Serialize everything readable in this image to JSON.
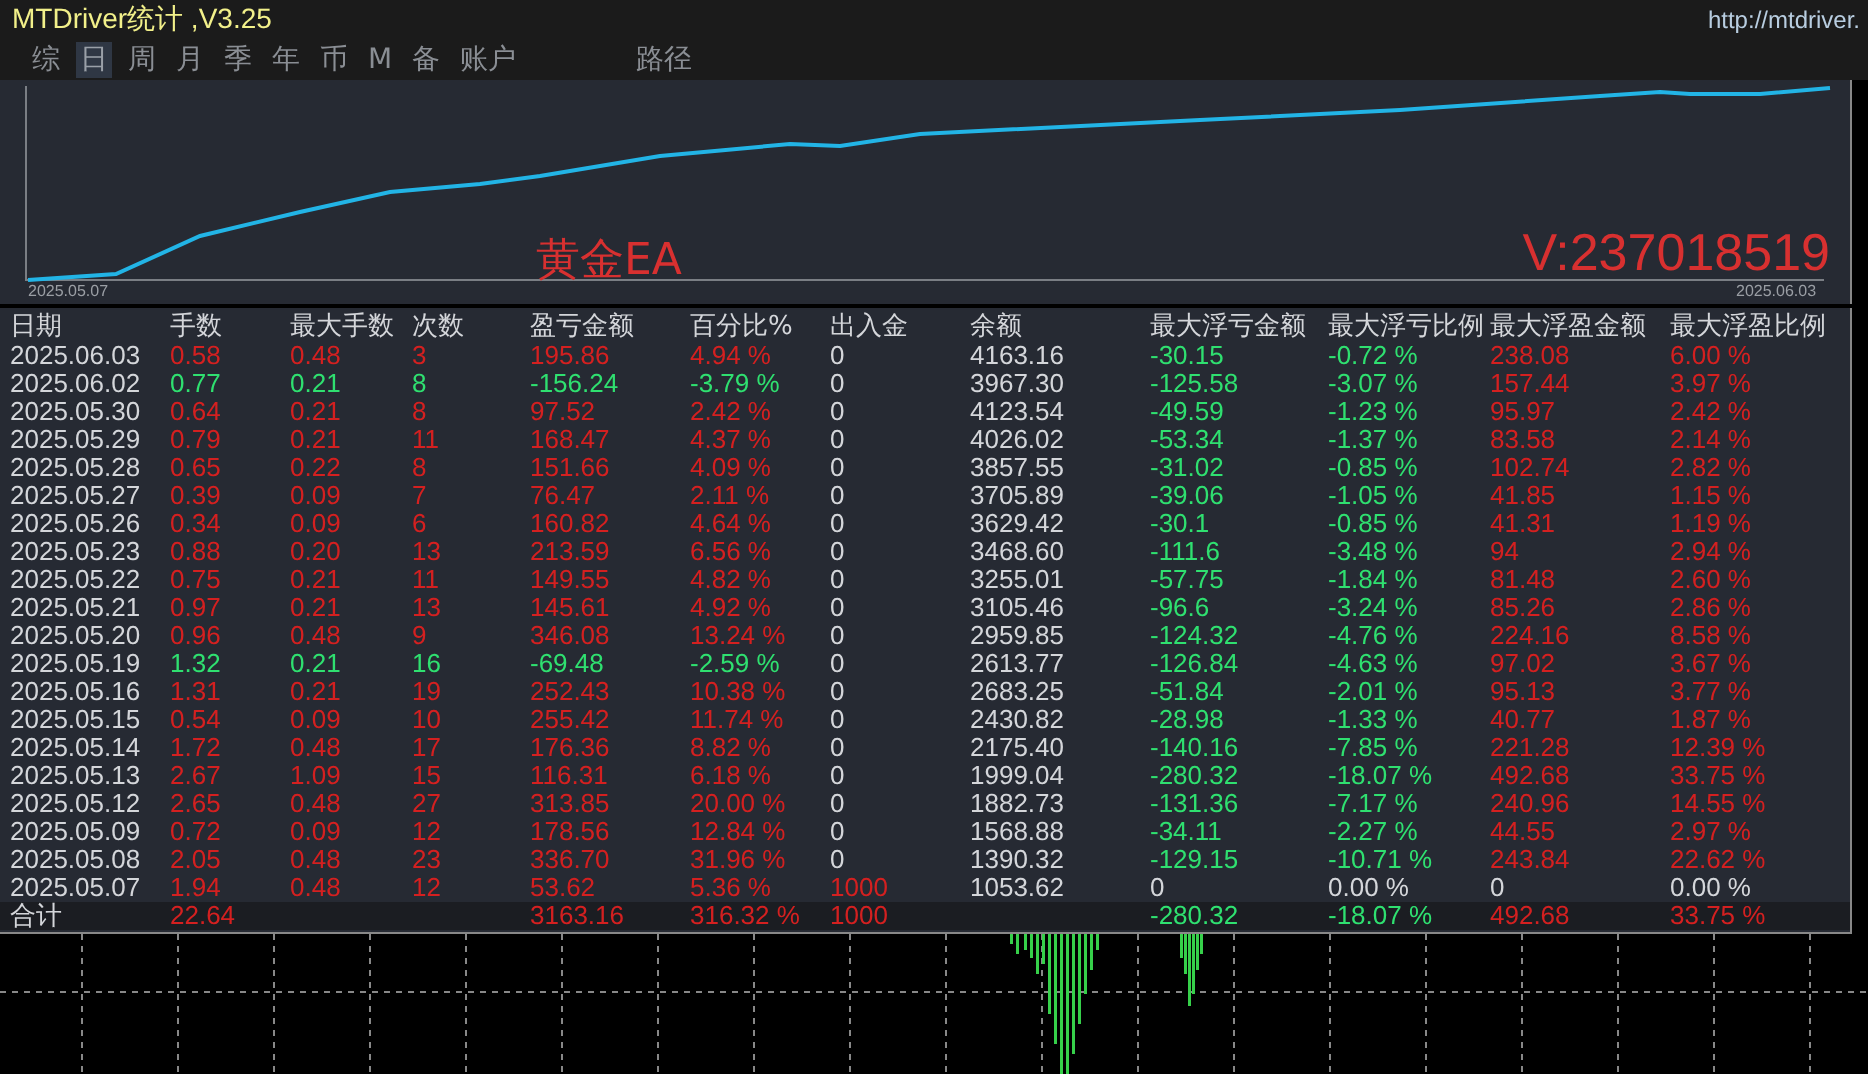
{
  "window": {
    "title": "MTDriver统计 ,V3.25",
    "url": "http://mtdriver."
  },
  "tabs": [
    {
      "label": "综",
      "selected": false
    },
    {
      "label": "日",
      "selected": true
    },
    {
      "label": "周",
      "selected": false
    },
    {
      "label": "月",
      "selected": false
    },
    {
      "label": "季",
      "selected": false
    },
    {
      "label": "年",
      "selected": false
    },
    {
      "label": "币",
      "selected": false
    },
    {
      "label": "M",
      "selected": false
    },
    {
      "label": "备",
      "selected": false
    },
    {
      "label": "账户",
      "selected": false
    },
    {
      "label": "路径",
      "selected": false
    }
  ],
  "chart": {
    "start_label": "2025.05.07",
    "end_label": "2025.06.03",
    "title": "黄金EA",
    "account": "V:237018519"
  },
  "table": {
    "columns": [
      "日期",
      "手数",
      "最大手数",
      "次数",
      "盈亏金额",
      "百分比%",
      "出入金",
      "余额",
      "最大浮亏金额",
      "最大浮亏比例",
      "最大浮盈金额",
      "最大浮盈比例"
    ],
    "rows": [
      {
        "cells": [
          {
            "text": "2025.06.03"
          },
          {
            "text": "0.58",
            "color": "#d42020"
          },
          {
            "text": "0.48",
            "color": "#d42020"
          },
          {
            "text": "3",
            "color": "#d42020"
          },
          {
            "text": "195.86",
            "color": "#d42020"
          },
          {
            "text": "4.94 %",
            "color": "#d42020"
          },
          {
            "text": "0"
          },
          {
            "text": "4163.16"
          },
          {
            "text": "-30.15",
            "color": "#2fe070"
          },
          {
            "text": "-0.72 %",
            "color": "#2fe070"
          },
          {
            "text": "238.08",
            "color": "#d42020"
          },
          {
            "text": "6.00 %",
            "color": "#d42020"
          }
        ]
      },
      {
        "cells": [
          {
            "text": "2025.06.02"
          },
          {
            "text": "0.77",
            "color": "#2fe070"
          },
          {
            "text": "0.21",
            "color": "#2fe070"
          },
          {
            "text": "8",
            "color": "#2fe070"
          },
          {
            "text": "-156.24",
            "color": "#2fe070"
          },
          {
            "text": "-3.79 %",
            "color": "#2fe070"
          },
          {
            "text": "0"
          },
          {
            "text": "3967.30"
          },
          {
            "text": "-125.58",
            "color": "#2fe070"
          },
          {
            "text": "-3.07 %",
            "color": "#2fe070"
          },
          {
            "text": "157.44",
            "color": "#d42020"
          },
          {
            "text": "3.97 %",
            "color": "#d42020"
          }
        ]
      },
      {
        "cells": [
          {
            "text": "2025.05.30"
          },
          {
            "text": "0.64",
            "color": "#d42020"
          },
          {
            "text": "0.21",
            "color": "#d42020"
          },
          {
            "text": "8",
            "color": "#d42020"
          },
          {
            "text": "97.52",
            "color": "#d42020"
          },
          {
            "text": "2.42 %",
            "color": "#d42020"
          },
          {
            "text": "0"
          },
          {
            "text": "4123.54"
          },
          {
            "text": "-49.59",
            "color": "#2fe070"
          },
          {
            "text": "-1.23 %",
            "color": "#2fe070"
          },
          {
            "text": "95.97",
            "color": "#d42020"
          },
          {
            "text": "2.42 %",
            "color": "#d42020"
          }
        ]
      },
      {
        "cells": [
          {
            "text": "2025.05.29"
          },
          {
            "text": "0.79",
            "color": "#d42020"
          },
          {
            "text": "0.21",
            "color": "#d42020"
          },
          {
            "text": "11",
            "color": "#d42020"
          },
          {
            "text": "168.47",
            "color": "#d42020"
          },
          {
            "text": "4.37 %",
            "color": "#d42020"
          },
          {
            "text": "0"
          },
          {
            "text": "4026.02"
          },
          {
            "text": "-53.34",
            "color": "#2fe070"
          },
          {
            "text": "-1.37 %",
            "color": "#2fe070"
          },
          {
            "text": "83.58",
            "color": "#d42020"
          },
          {
            "text": "2.14 %",
            "color": "#d42020"
          }
        ]
      },
      {
        "cells": [
          {
            "text": "2025.05.28"
          },
          {
            "text": "0.65",
            "color": "#d42020"
          },
          {
            "text": "0.22",
            "color": "#d42020"
          },
          {
            "text": "8",
            "color": "#d42020"
          },
          {
            "text": "151.66",
            "color": "#d42020"
          },
          {
            "text": "4.09 %",
            "color": "#d42020"
          },
          {
            "text": "0"
          },
          {
            "text": "3857.55"
          },
          {
            "text": "-31.02",
            "color": "#2fe070"
          },
          {
            "text": "-0.85 %",
            "color": "#2fe070"
          },
          {
            "text": "102.74",
            "color": "#d42020"
          },
          {
            "text": "2.82 %",
            "color": "#d42020"
          }
        ]
      },
      {
        "cells": [
          {
            "text": "2025.05.27"
          },
          {
            "text": "0.39",
            "color": "#d42020"
          },
          {
            "text": "0.09",
            "color": "#d42020"
          },
          {
            "text": "7",
            "color": "#d42020"
          },
          {
            "text": "76.47",
            "color": "#d42020"
          },
          {
            "text": "2.11 %",
            "color": "#d42020"
          },
          {
            "text": "0"
          },
          {
            "text": "3705.89"
          },
          {
            "text": "-39.06",
            "color": "#2fe070"
          },
          {
            "text": "-1.05 %",
            "color": "#2fe070"
          },
          {
            "text": "41.85",
            "color": "#d42020"
          },
          {
            "text": "1.15 %",
            "color": "#d42020"
          }
        ]
      },
      {
        "cells": [
          {
            "text": "2025.05.26"
          },
          {
            "text": "0.34",
            "color": "#d42020"
          },
          {
            "text": "0.09",
            "color": "#d42020"
          },
          {
            "text": "6",
            "color": "#d42020"
          },
          {
            "text": "160.82",
            "color": "#d42020"
          },
          {
            "text": "4.64 %",
            "color": "#d42020"
          },
          {
            "text": "0"
          },
          {
            "text": "3629.42"
          },
          {
            "text": "-30.1",
            "color": "#2fe070"
          },
          {
            "text": "-0.85 %",
            "color": "#2fe070"
          },
          {
            "text": "41.31",
            "color": "#d42020"
          },
          {
            "text": "1.19 %",
            "color": "#d42020"
          }
        ]
      },
      {
        "cells": [
          {
            "text": "2025.05.23"
          },
          {
            "text": "0.88",
            "color": "#d42020"
          },
          {
            "text": "0.20",
            "color": "#d42020"
          },
          {
            "text": "13",
            "color": "#d42020"
          },
          {
            "text": "213.59",
            "color": "#d42020"
          },
          {
            "text": "6.56 %",
            "color": "#d42020"
          },
          {
            "text": "0"
          },
          {
            "text": "3468.60"
          },
          {
            "text": "-111.6",
            "color": "#2fe070"
          },
          {
            "text": "-3.48 %",
            "color": "#2fe070"
          },
          {
            "text": "94",
            "color": "#d42020"
          },
          {
            "text": "2.94 %",
            "color": "#d42020"
          }
        ]
      },
      {
        "cells": [
          {
            "text": "2025.05.22"
          },
          {
            "text": "0.75",
            "color": "#d42020"
          },
          {
            "text": "0.21",
            "color": "#d42020"
          },
          {
            "text": "11",
            "color": "#d42020"
          },
          {
            "text": "149.55",
            "color": "#d42020"
          },
          {
            "text": "4.82 %",
            "color": "#d42020"
          },
          {
            "text": "0"
          },
          {
            "text": "3255.01"
          },
          {
            "text": "-57.75",
            "color": "#2fe070"
          },
          {
            "text": "-1.84 %",
            "color": "#2fe070"
          },
          {
            "text": "81.48",
            "color": "#d42020"
          },
          {
            "text": "2.60 %",
            "color": "#d42020"
          }
        ]
      },
      {
        "cells": [
          {
            "text": "2025.05.21"
          },
          {
            "text": "0.97",
            "color": "#d42020"
          },
          {
            "text": "0.21",
            "color": "#d42020"
          },
          {
            "text": "13",
            "color": "#d42020"
          },
          {
            "text": "145.61",
            "color": "#d42020"
          },
          {
            "text": "4.92 %",
            "color": "#d42020"
          },
          {
            "text": "0"
          },
          {
            "text": "3105.46"
          },
          {
            "text": "-96.6",
            "color": "#2fe070"
          },
          {
            "text": "-3.24 %",
            "color": "#2fe070"
          },
          {
            "text": "85.26",
            "color": "#d42020"
          },
          {
            "text": "2.86 %",
            "color": "#d42020"
          }
        ]
      },
      {
        "cells": [
          {
            "text": "2025.05.20"
          },
          {
            "text": "0.96",
            "color": "#d42020"
          },
          {
            "text": "0.48",
            "color": "#d42020"
          },
          {
            "text": "9",
            "color": "#d42020"
          },
          {
            "text": "346.08",
            "color": "#d42020"
          },
          {
            "text": "13.24 %",
            "color": "#d42020"
          },
          {
            "text": "0"
          },
          {
            "text": "2959.85"
          },
          {
            "text": "-124.32",
            "color": "#2fe070"
          },
          {
            "text": "-4.76 %",
            "color": "#2fe070"
          },
          {
            "text": "224.16",
            "color": "#d42020"
          },
          {
            "text": "8.58 %",
            "color": "#d42020"
          }
        ]
      },
      {
        "cells": [
          {
            "text": "2025.05.19"
          },
          {
            "text": "1.32",
            "color": "#2fe070"
          },
          {
            "text": "0.21",
            "color": "#2fe070"
          },
          {
            "text": "16",
            "color": "#2fe070"
          },
          {
            "text": "-69.48",
            "color": "#2fe070"
          },
          {
            "text": "-2.59 %",
            "color": "#2fe070"
          },
          {
            "text": "0"
          },
          {
            "text": "2613.77"
          },
          {
            "text": "-126.84",
            "color": "#2fe070"
          },
          {
            "text": "-4.63 %",
            "color": "#2fe070"
          },
          {
            "text": "97.02",
            "color": "#d42020"
          },
          {
            "text": "3.67 %",
            "color": "#d42020"
          }
        ]
      },
      {
        "cells": [
          {
            "text": "2025.05.16"
          },
          {
            "text": "1.31",
            "color": "#d42020"
          },
          {
            "text": "0.21",
            "color": "#d42020"
          },
          {
            "text": "19",
            "color": "#d42020"
          },
          {
            "text": "252.43",
            "color": "#d42020"
          },
          {
            "text": "10.38 %",
            "color": "#d42020"
          },
          {
            "text": "0"
          },
          {
            "text": "2683.25"
          },
          {
            "text": "-51.84",
            "color": "#2fe070"
          },
          {
            "text": "-2.01 %",
            "color": "#2fe070"
          },
          {
            "text": "95.13",
            "color": "#d42020"
          },
          {
            "text": "3.77 %",
            "color": "#d42020"
          }
        ]
      },
      {
        "cells": [
          {
            "text": "2025.05.15"
          },
          {
            "text": "0.54",
            "color": "#d42020"
          },
          {
            "text": "0.09",
            "color": "#d42020"
          },
          {
            "text": "10",
            "color": "#d42020"
          },
          {
            "text": "255.42",
            "color": "#d42020"
          },
          {
            "text": "11.74 %",
            "color": "#d42020"
          },
          {
            "text": "0"
          },
          {
            "text": "2430.82"
          },
          {
            "text": "-28.98",
            "color": "#2fe070"
          },
          {
            "text": "-1.33 %",
            "color": "#2fe070"
          },
          {
            "text": "40.77",
            "color": "#d42020"
          },
          {
            "text": "1.87 %",
            "color": "#d42020"
          }
        ]
      },
      {
        "cells": [
          {
            "text": "2025.05.14"
          },
          {
            "text": "1.72",
            "color": "#d42020"
          },
          {
            "text": "0.48",
            "color": "#d42020"
          },
          {
            "text": "17",
            "color": "#d42020"
          },
          {
            "text": "176.36",
            "color": "#d42020"
          },
          {
            "text": "8.82 %",
            "color": "#d42020"
          },
          {
            "text": "0"
          },
          {
            "text": "2175.40"
          },
          {
            "text": "-140.16",
            "color": "#2fe070"
          },
          {
            "text": "-7.85 %",
            "color": "#2fe070"
          },
          {
            "text": "221.28",
            "color": "#d42020"
          },
          {
            "text": "12.39 %",
            "color": "#d42020"
          }
        ]
      },
      {
        "cells": [
          {
            "text": "2025.05.13"
          },
          {
            "text": "2.67",
            "color": "#d42020"
          },
          {
            "text": "1.09",
            "color": "#d42020"
          },
          {
            "text": "15",
            "color": "#d42020"
          },
          {
            "text": "116.31",
            "color": "#d42020"
          },
          {
            "text": "6.18 %",
            "color": "#d42020"
          },
          {
            "text": "0"
          },
          {
            "text": "1999.04"
          },
          {
            "text": "-280.32",
            "color": "#2fe070"
          },
          {
            "text": "-18.07 %",
            "color": "#2fe070"
          },
          {
            "text": "492.68",
            "color": "#d42020"
          },
          {
            "text": "33.75 %",
            "color": "#d42020"
          }
        ]
      },
      {
        "cells": [
          {
            "text": "2025.05.12"
          },
          {
            "text": "2.65",
            "color": "#d42020"
          },
          {
            "text": "0.48",
            "color": "#d42020"
          },
          {
            "text": "27",
            "color": "#d42020"
          },
          {
            "text": "313.85",
            "color": "#d42020"
          },
          {
            "text": "20.00 %",
            "color": "#d42020"
          },
          {
            "text": "0"
          },
          {
            "text": "1882.73"
          },
          {
            "text": "-131.36",
            "color": "#2fe070"
          },
          {
            "text": "-7.17 %",
            "color": "#2fe070"
          },
          {
            "text": "240.96",
            "color": "#d42020"
          },
          {
            "text": "14.55 %",
            "color": "#d42020"
          }
        ]
      },
      {
        "cells": [
          {
            "text": "2025.05.09"
          },
          {
            "text": "0.72",
            "color": "#d42020"
          },
          {
            "text": "0.09",
            "color": "#d42020"
          },
          {
            "text": "12",
            "color": "#d42020"
          },
          {
            "text": "178.56",
            "color": "#d42020"
          },
          {
            "text": "12.84 %",
            "color": "#d42020"
          },
          {
            "text": "0"
          },
          {
            "text": "1568.88"
          },
          {
            "text": "-34.11",
            "color": "#2fe070"
          },
          {
            "text": "-2.27 %",
            "color": "#2fe070"
          },
          {
            "text": "44.55",
            "color": "#d42020"
          },
          {
            "text": "2.97 %",
            "color": "#d42020"
          }
        ]
      },
      {
        "cells": [
          {
            "text": "2025.05.08"
          },
          {
            "text": "2.05",
            "color": "#d42020"
          },
          {
            "text": "0.48",
            "color": "#d42020"
          },
          {
            "text": "23",
            "color": "#d42020"
          },
          {
            "text": "336.70",
            "color": "#d42020"
          },
          {
            "text": "31.96 %",
            "color": "#d42020"
          },
          {
            "text": "0"
          },
          {
            "text": "1390.32"
          },
          {
            "text": "-129.15",
            "color": "#2fe070"
          },
          {
            "text": "-10.71 %",
            "color": "#2fe070"
          },
          {
            "text": "243.84",
            "color": "#d42020"
          },
          {
            "text": "22.62 %",
            "color": "#d42020"
          }
        ]
      },
      {
        "cells": [
          {
            "text": "2025.05.07"
          },
          {
            "text": "1.94",
            "color": "#d42020"
          },
          {
            "text": "0.48",
            "color": "#d42020"
          },
          {
            "text": "12",
            "color": "#d42020"
          },
          {
            "text": "53.62",
            "color": "#d42020"
          },
          {
            "text": "5.36 %",
            "color": "#d42020"
          },
          {
            "text": "1000",
            "color": "#d42020"
          },
          {
            "text": "1053.62"
          },
          {
            "text": "0"
          },
          {
            "text": "0.00 %"
          },
          {
            "text": "0"
          },
          {
            "text": "0.00 %"
          }
        ]
      }
    ],
    "total": {
      "cells": [
        {
          "text": "合计"
        },
        {
          "text": "22.64",
          "color": "#d42020"
        },
        null,
        null,
        {
          "text": "3163.16",
          "color": "#d42020"
        },
        {
          "text": "316.32 %",
          "color": "#d42020"
        },
        {
          "text": "1000",
          "color": "#d42020"
        },
        null,
        {
          "text": "-280.32",
          "color": "#2fe070"
        },
        {
          "text": "-18.07 %",
          "color": "#2fe070"
        },
        {
          "text": "492.68",
          "color": "#d42020"
        },
        {
          "text": "33.75 %",
          "color": "#d42020"
        }
      ]
    }
  }
}
